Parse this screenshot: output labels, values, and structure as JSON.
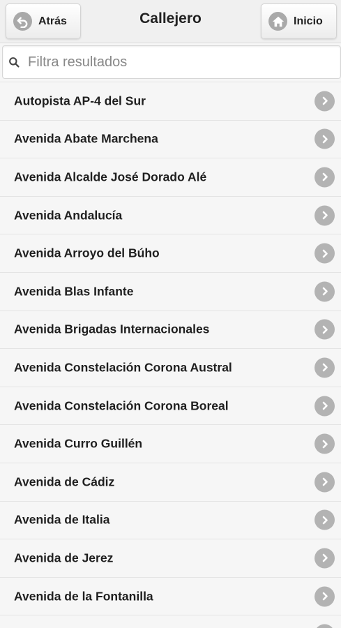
{
  "header": {
    "title": "Callejero",
    "back_label": "Atrás",
    "home_label": "Inicio"
  },
  "search": {
    "placeholder": "Filtra resultados",
    "value": ""
  },
  "streets": [
    "Autopista AP-4 del Sur",
    "Avenida Abate Marchena",
    "Avenida Alcalde José Dorado Alé",
    "Avenida Andalucía",
    "Avenida Arroyo del Búho",
    "Avenida Blas Infante",
    "Avenida Brigadas Internacionales",
    "Avenida Constelación Corona Austral",
    "Avenida Constelación Corona Boreal",
    "Avenida Curro Guillén",
    "Avenida de Cádiz",
    "Avenida de Italia",
    "Avenida de Jerez",
    "Avenida de la Fontanilla",
    ""
  ],
  "icons": {
    "back": "back-arrow-icon",
    "home": "home-icon",
    "search": "search-icon",
    "row": "chevron-right-icon"
  },
  "colors": {
    "icon_gray": "#a9a9a9",
    "background": "#f6f6f6"
  }
}
